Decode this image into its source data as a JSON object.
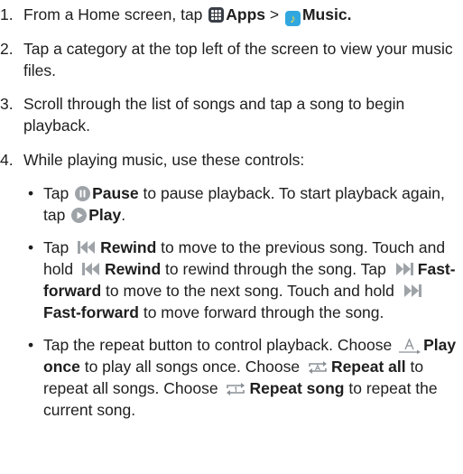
{
  "steps": [
    {
      "num": "1.",
      "parts": {
        "pre": "From a Home screen, tap ",
        "apps_label": "Apps",
        "sep": " > ",
        "music_label": "Music."
      }
    },
    {
      "num": "2.",
      "text": "Tap a category at the top left of the screen to view your music files."
    },
    {
      "num": "3.",
      "text": "Scroll through the list of songs and tap a song to begin playback."
    },
    {
      "num": "4.",
      "text": "While playing music, use these controls:"
    }
  ],
  "bullets": {
    "dot": "•",
    "b1": {
      "t1": "Tap ",
      "pause": "Pause",
      "t2": " to pause playback. To start playback again, tap ",
      "play": "Play",
      "t3": "."
    },
    "b2": {
      "t1": "Tap ",
      "rewind": "Rewind",
      "t2": " to move to the previous song. Touch and hold ",
      "rewind2": "Rewind",
      "t3": " to rewind through the song. Tap ",
      "ff": "Fast-forward",
      "t4": " to move to the next song. Touch and hold ",
      "ff2": "Fast-forward",
      "t5": " to move forward through the song."
    },
    "b3": {
      "t1": "Tap the repeat button to control playback. Choose ",
      "once": "Play once",
      "t2": " to play all songs once. Choose ",
      "all": "Repeat all",
      "t3": " to repeat all songs. Choose ",
      "song": "Repeat song",
      "t4": " to repeat the current song."
    }
  },
  "icons": {
    "apps": "apps-grid-icon",
    "music": "music-app-icon",
    "pause": "pause-icon",
    "play": "play-icon",
    "rewind": "rewind-icon",
    "fast_forward": "fast-forward-icon",
    "play_once": "play-once-icon",
    "repeat_all": "repeat-all-icon",
    "repeat_song": "repeat-song-icon"
  },
  "colors": {
    "text": "#1e1e1e",
    "apps_icon": "#3a3f47",
    "music_icon": "#30a7df",
    "control_icon": "#9ea3a8"
  }
}
